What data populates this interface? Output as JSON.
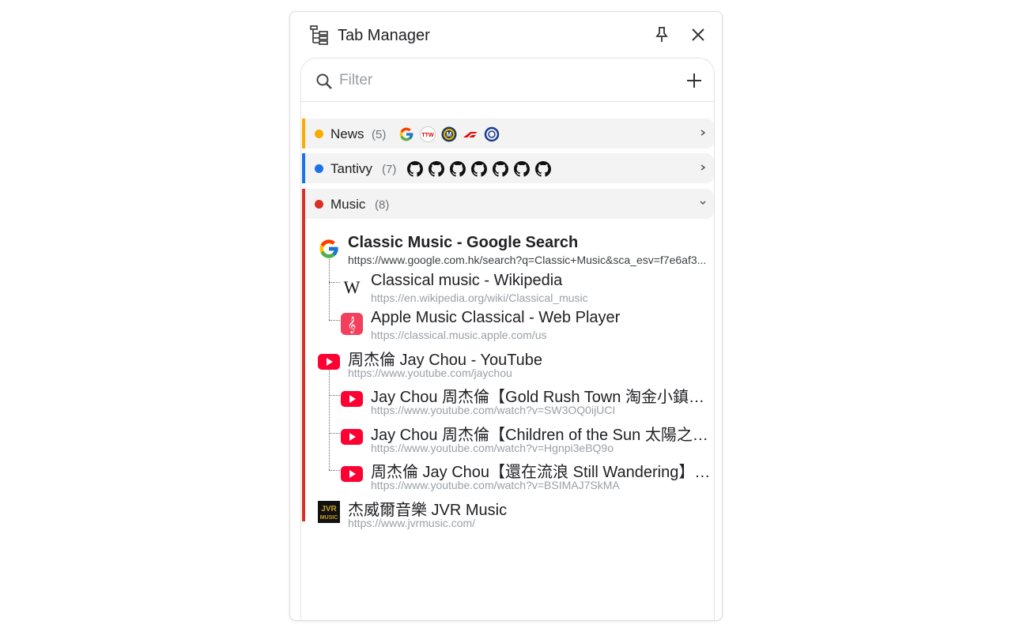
{
  "app": {
    "title": "Tab Manager"
  },
  "search": {
    "placeholder": "Filter"
  },
  "colors": {
    "news": "#f9ab00",
    "tantivy": "#1a73e8",
    "music": "#d93025"
  },
  "groups": [
    {
      "name": "News",
      "count": "(5)",
      "expanded": false,
      "favicons": [
        "google-icon",
        "ttw-icon",
        "motorsport-icon",
        "f1-icon",
        "ring-logo-icon"
      ]
    },
    {
      "name": "Tantivy",
      "count": "(7)",
      "expanded": false,
      "favicons": [
        "github-icon",
        "github-icon",
        "github-icon",
        "github-icon",
        "github-icon",
        "github-icon",
        "github-icon"
      ]
    },
    {
      "name": "Music",
      "count": "(8)",
      "expanded": true,
      "tabs": [
        {
          "title": "Classic Music - Google Search",
          "url": "https://www.google.com.hk/search?q=Classic+Music&sca_esv=f7e6af3...",
          "icon": "google-icon",
          "level": 0,
          "active": true
        },
        {
          "title": "Classical music - Wikipedia",
          "url": "https://en.wikipedia.org/wiki/Classical_music",
          "icon": "wikipedia-icon",
          "level": 1
        },
        {
          "title": "Apple Music Classical - Web Player",
          "url": "https://classical.music.apple.com/us",
          "icon": "apple-music-classical-icon",
          "level": 1
        },
        {
          "title": "周杰倫 Jay Chou - YouTube",
          "url": "https://www.youtube.com/jaychou",
          "icon": "youtube-icon",
          "level": 0
        },
        {
          "title": "Jay Chou 周杰倫【Gold Rush Town 淘金小鎮】Official MV",
          "url": "https://www.youtube.com/watch?v=SW3OQ0ijUCI",
          "icon": "youtube-icon",
          "level": 1
        },
        {
          "title": "Jay Chou 周杰倫【Children of the Sun 太陽之子】Official MV",
          "url": "https://www.youtube.com/watch?v=Hgnpi3eBQ9o",
          "icon": "youtube-icon",
          "level": 1
        },
        {
          "title": "周杰倫 Jay Chou【還在流浪 Still Wandering】Official MV",
          "url": "https://www.youtube.com/watch?v=BSIMAJ7SkMA",
          "icon": "youtube-icon",
          "level": 1
        },
        {
          "title": "杰威爾音樂 JVR Music",
          "url": "https://www.jvrmusic.com/",
          "icon": "jvr-music-icon",
          "level": 0
        }
      ]
    }
  ]
}
